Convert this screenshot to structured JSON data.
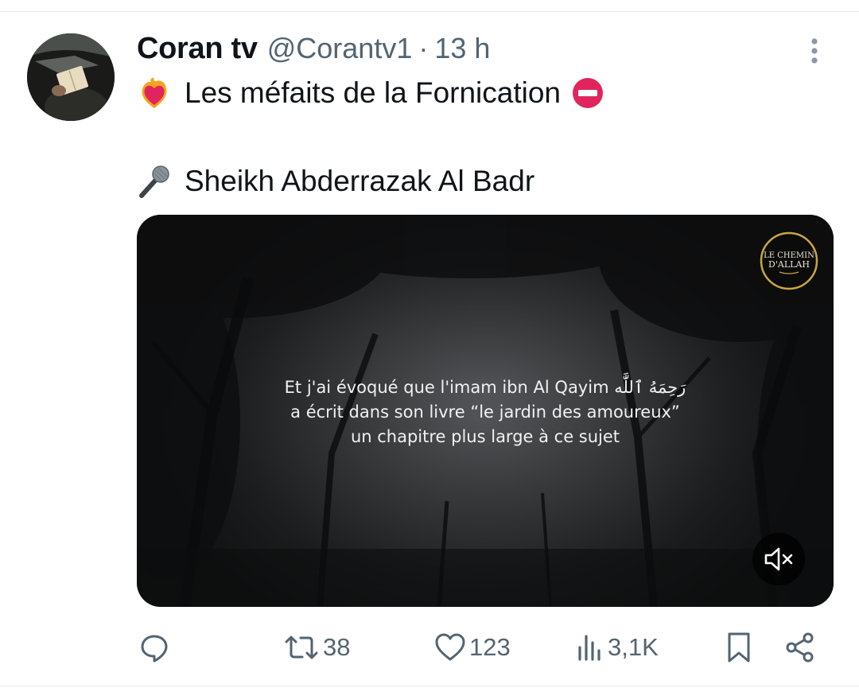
{
  "tweet": {
    "display_name": "Coran tv",
    "handle": "@Corantv1",
    "separator": "·",
    "time": "13 h",
    "line1_emoji": "heart-on-fire",
    "line1_text": "Les méfaits de la Fornication",
    "line1_trailing_emoji": "no-entry",
    "line2_emoji": "microphone",
    "line2_text": "Sheikh Abderrazak Al Badr"
  },
  "video": {
    "caption_line1": "Et j'ai évoqué que l'imam ibn Al Qayim رَحِمَهُ ٱللَّٰه",
    "caption_line2": "a écrit dans son livre “le jardin des amoureux”",
    "caption_line3": "un chapitre plus large à ce sujet",
    "logo_line1": "LE CHEMIN",
    "logo_line2": "D'ALLAH",
    "muted": true
  },
  "actions": {
    "reply_count": "",
    "retweet_count": "38",
    "like_count": "123",
    "views_count": "3,1K"
  },
  "colors": {
    "text_primary": "#0f1419",
    "text_secondary": "#536471",
    "divider": "#e6e9ec",
    "logo_gold": "#c9a640"
  }
}
